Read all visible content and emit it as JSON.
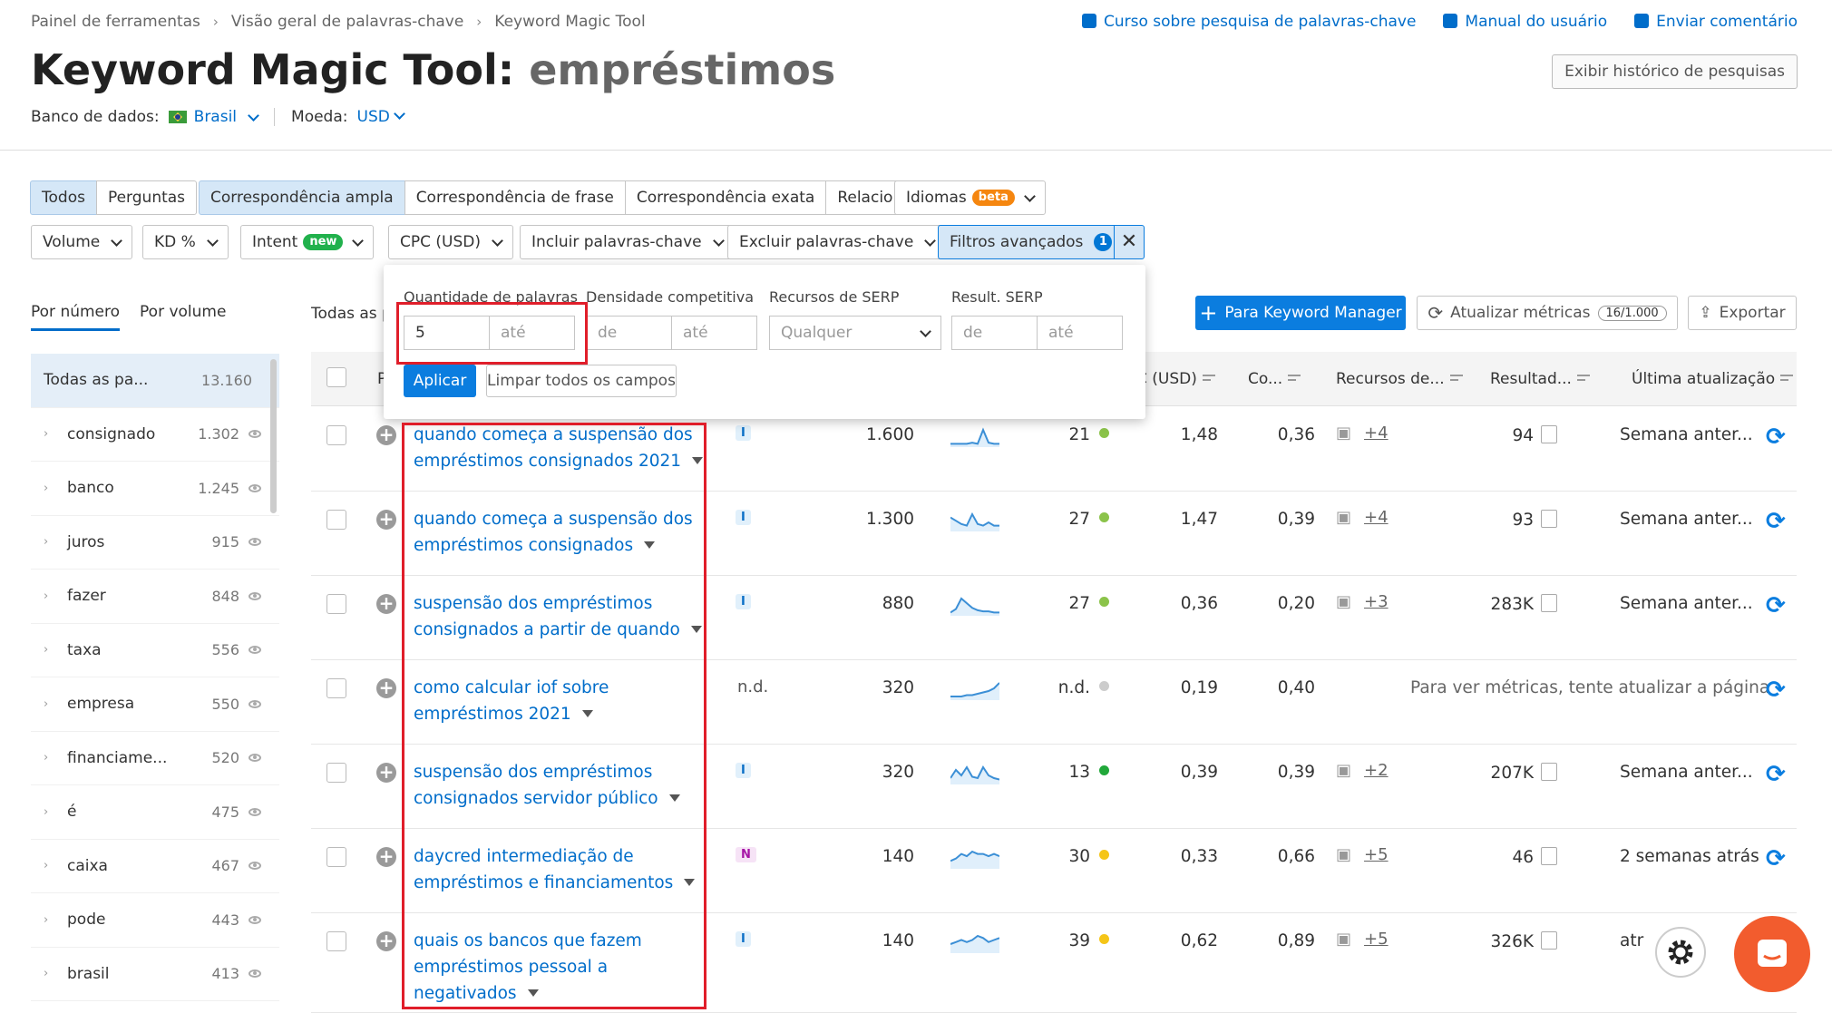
{
  "breadcrumb": [
    "Painel de ferramentas",
    "Visão geral de palavras-chave",
    "Keyword Magic Tool"
  ],
  "top_links": [
    "Curso sobre pesquisa de palavras-chave",
    "Manual do usuário",
    "Enviar comentário"
  ],
  "title": {
    "prefix": "Keyword Magic Tool:",
    "keyword": "empréstimos"
  },
  "history_button": "Exibir histórico de pesquisas",
  "database": {
    "label": "Banco de dados:",
    "value": "Brasil"
  },
  "currency": {
    "label": "Moeda:",
    "value": "USD"
  },
  "tabs_scope": [
    "Todos",
    "Perguntas"
  ],
  "tabs_match": [
    "Correspondência ampla",
    "Correspondência de frase",
    "Correspondência exata",
    "Relacionadas"
  ],
  "languages": {
    "label": "Idiomas",
    "badge": "beta"
  },
  "filters": {
    "volume": "Volume",
    "kd": "KD %",
    "intent": "Intent",
    "intent_badge": "new",
    "cpc": "CPC (USD)",
    "include": "Incluir palavras-chave",
    "exclude": "Excluir palavras-chave",
    "advanced": "Filtros avançados",
    "advanced_count": "1"
  },
  "popup": {
    "word_count_label": "Quantidade de palavras",
    "word_count_from": "5",
    "word_count_to_ph": "até",
    "density_label": "Densidade competitiva",
    "density_from_ph": "de",
    "density_to_ph": "até",
    "serp_features_label": "Recursos de SERP",
    "serp_features_value": "Qualquer",
    "serp_results_label": "Result. SERP",
    "serp_from_ph": "de",
    "serp_to_ph": "até",
    "apply": "Aplicar",
    "clear": "Limpar todos os campos"
  },
  "sidebar": {
    "tab_number": "Por número",
    "tab_volume": "Por volume",
    "items": [
      {
        "label": "Todas as pa...",
        "count": "13.160"
      },
      {
        "label": "consignado",
        "count": "1.302"
      },
      {
        "label": "banco",
        "count": "1.245"
      },
      {
        "label": "juros",
        "count": "915"
      },
      {
        "label": "fazer",
        "count": "848"
      },
      {
        "label": "taxa",
        "count": "556"
      },
      {
        "label": "empresa",
        "count": "550"
      },
      {
        "label": "financiame...",
        "count": "520"
      },
      {
        "label": "é",
        "count": "475"
      },
      {
        "label": "caixa",
        "count": "467"
      },
      {
        "label": "pode",
        "count": "443"
      },
      {
        "label": "brasil",
        "count": "413"
      }
    ]
  },
  "table_label": "Todas as p",
  "actions": {
    "keyword_manager": "Para Keyword Manager",
    "update": "Atualizar métricas",
    "update_count": "16/1.000",
    "export": "Exportar"
  },
  "columns": {
    "cpc": "C (USD)",
    "com": "Co...",
    "serp": "Recursos de...",
    "results": "Resultad...",
    "updated": "Última atualização"
  },
  "rows": [
    {
      "keyword": [
        "quando começa a suspensão dos",
        "empréstimos consignados 2021"
      ],
      "intent": "I",
      "volume": "1.600",
      "kd": "21",
      "kd_color": "#8bc34a",
      "cpc": "1,48",
      "com": "0,36",
      "serp_more": "+4",
      "results": "94",
      "updated": "Semana anter...",
      "spark": [
        2,
        2,
        2,
        2,
        3,
        2,
        14,
        3,
        2,
        2
      ]
    },
    {
      "keyword": [
        "quando começa a suspensão dos",
        "empréstimos consignados"
      ],
      "intent": "I",
      "volume": "1.300",
      "kd": "27",
      "kd_color": "#8bc34a",
      "cpc": "1,47",
      "com": "0,39",
      "serp_more": "+4",
      "results": "93",
      "updated": "Semana anter...",
      "spark": [
        8,
        6,
        4,
        3,
        10,
        4,
        3,
        5,
        3,
        3
      ]
    },
    {
      "keyword": [
        "suspensão dos empréstimos",
        "consignados a partir de quando"
      ],
      "intent": "I",
      "volume": "880",
      "kd": "27",
      "kd_color": "#8bc34a",
      "cpc": "0,36",
      "com": "0,20",
      "serp_more": "+3",
      "results": "283K",
      "updated": "Semana anter...",
      "spark": [
        2,
        5,
        14,
        10,
        6,
        4,
        3,
        3,
        2,
        2
      ]
    },
    {
      "keyword": [
        "como calcular iof sobre",
        "empréstimos 2021"
      ],
      "intent": "n.d.",
      "volume": "320",
      "kd": "n.d.",
      "kd_color": "#cccccc",
      "cpc": "0,19",
      "com": "0,40",
      "serp_more": "",
      "results": "",
      "updated": "Para ver métricas, tente atualizar a página",
      "spark": [
        2,
        2,
        2,
        3,
        3,
        4,
        5,
        6,
        8,
        12
      ]
    },
    {
      "keyword": [
        "suspensão dos empréstimos",
        "consignados servidor público"
      ],
      "intent": "I",
      "volume": "320",
      "kd": "13",
      "kd_color": "#21a83a",
      "cpc": "0,39",
      "com": "0,39",
      "serp_more": "+2",
      "results": "207K",
      "updated": "Semana anter...",
      "spark": [
        4,
        10,
        6,
        12,
        5,
        4,
        12,
        6,
        4,
        3
      ]
    },
    {
      "keyword": [
        "daycred intermediação de",
        "empréstimos e financiamentos"
      ],
      "intent": "N",
      "volume": "140",
      "kd": "30",
      "kd_color": "#f5c518",
      "cpc": "0,33",
      "com": "0,66",
      "serp_more": "+5",
      "results": "46",
      "updated": "2 semanas atrás",
      "spark": [
        3,
        4,
        6,
        5,
        7,
        6,
        6,
        5,
        6,
        5
      ]
    },
    {
      "keyword": [
        "quais os bancos que fazem",
        "empréstimos pessoal a",
        "negativados"
      ],
      "intent": "I",
      "volume": "140",
      "kd": "39",
      "kd_color": "#f5c518",
      "cpc": "0,62",
      "com": "0,89",
      "serp_more": "+5",
      "results": "326K",
      "updated": "atr",
      "spark": [
        4,
        5,
        6,
        5,
        6,
        8,
        7,
        5,
        6,
        7
      ]
    }
  ],
  "colors": {
    "accent": "#006dca",
    "primary_button": "#0b7ddf",
    "highlight": "#e01e2a",
    "chat": "#f25c2e"
  }
}
